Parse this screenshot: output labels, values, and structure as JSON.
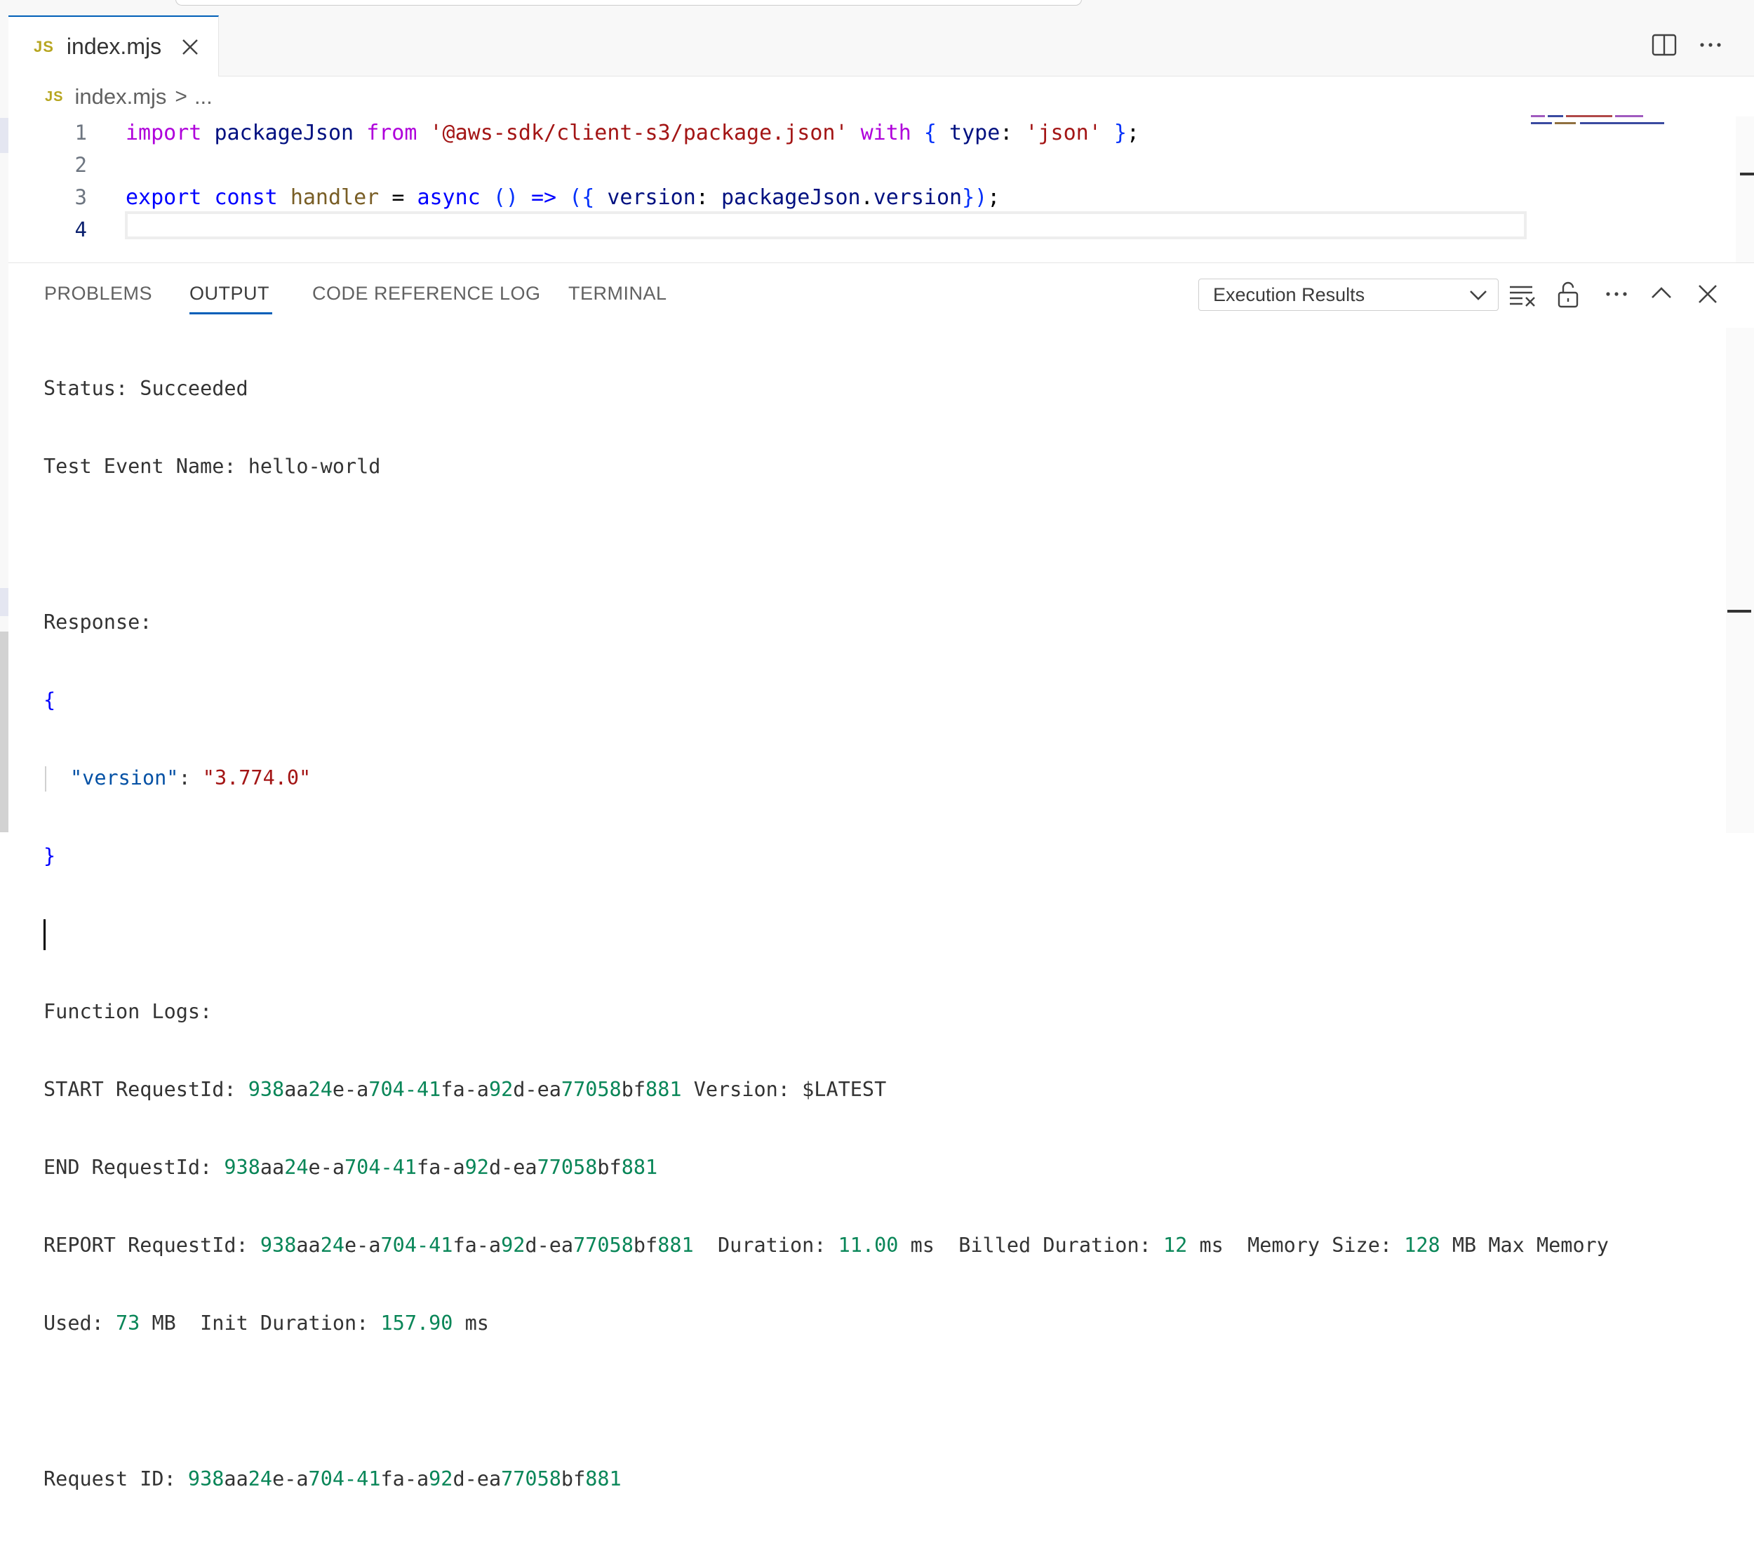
{
  "tab": {
    "lang_badge": "JS",
    "file_name": "index.mjs"
  },
  "breadcrumb": {
    "lang_badge": "JS",
    "file": "index.mjs",
    "separator": ">",
    "more": "..."
  },
  "editor": {
    "lines": [
      {
        "number": "1"
      },
      {
        "number": "2"
      },
      {
        "number": "3"
      },
      {
        "number": "4"
      }
    ],
    "code": {
      "l1": {
        "import": "import",
        "name": "packageJson",
        "from": "from",
        "module": "'@aws-sdk/client-s3/package.json'",
        "with": "with",
        "open": "{",
        "type_key": "type",
        "colon": ":",
        "type_val": "'json'",
        "close": "}",
        "semi": ";"
      },
      "l3": {
        "export": "export",
        "const": "const",
        "handler": "handler",
        "eq": "=",
        "async": "async",
        "parens": "()",
        "arrow": "=>",
        "open": "({",
        "version_key": "version",
        "colon": ":",
        "ref_obj": "packageJson",
        "dot": ".",
        "ref_prop": "version",
        "close": "})",
        "semi": ";"
      }
    }
  },
  "panel": {
    "tabs": [
      "PROBLEMS",
      "OUTPUT",
      "CODE REFERENCE LOG",
      "TERMINAL"
    ],
    "active_tab": "OUTPUT",
    "channel": "Execution Results"
  },
  "output": {
    "status_label": "Status:",
    "status_value": "Succeeded",
    "event_label": "Test Event Name:",
    "event_value": "hello-world",
    "response_label": "Response:",
    "json_open": "{",
    "json_key": "\"version\"",
    "json_colon": ":",
    "json_value": "\"3.774.0\"",
    "json_close": "}",
    "logs_label": "Function Logs:",
    "start": {
      "prefix": "START RequestId:",
      "id_parts": [
        "938",
        "aa",
        "24",
        "e-a",
        "704-41",
        "fa-a",
        "92",
        "d-ea",
        "77058",
        "bf",
        "881"
      ],
      "version_label": "Version:",
      "version_value": "$LATEST"
    },
    "end": {
      "prefix": "END RequestId:"
    },
    "report": {
      "prefix": "REPORT RequestId:",
      "duration_label": "Duration:",
      "duration_value": "11.00",
      "duration_unit": "ms",
      "billed_label": "Billed Duration:",
      "billed_value": "12",
      "billed_unit": "ms",
      "memory_label": "Memory Size:",
      "memory_value": "128",
      "memory_unit": "MB",
      "max_label": "Max Memory",
      "used_label": "Used:",
      "used_value": "73",
      "used_unit": "MB",
      "init_label": "Init Duration:",
      "init_value": "157.90",
      "init_unit": "ms"
    },
    "request_id_label": "Request ID:"
  }
}
